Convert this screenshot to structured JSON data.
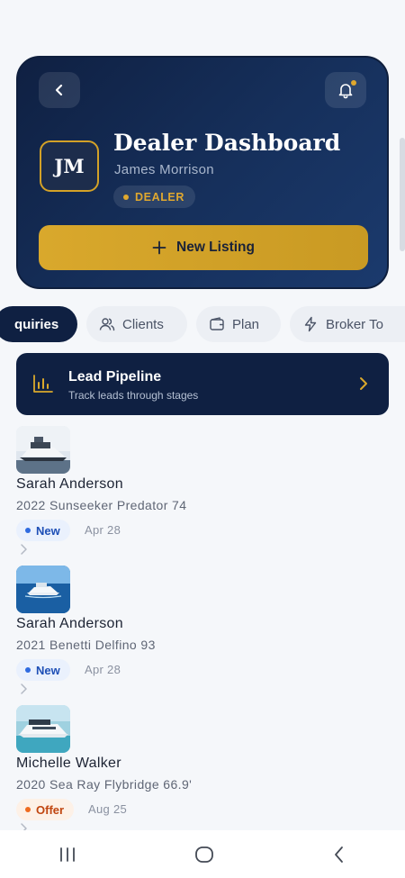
{
  "header": {
    "title": "Dealer Dashboard",
    "user_name": "James Morrison",
    "initials": "JM",
    "role_badge": "DEALER",
    "new_listing_label": "New Listing"
  },
  "tabs": [
    {
      "label": "quiries",
      "active": true
    },
    {
      "label": "Clients",
      "active": false
    },
    {
      "label": "Plan",
      "active": false
    },
    {
      "label": "Broker To",
      "active": false
    }
  ],
  "pipeline": {
    "title": "Lead Pipeline",
    "subtitle": "Track leads through stages"
  },
  "inquiries": [
    {
      "name": "Sarah Anderson",
      "yacht": "2022 Sunseeker Predator 74",
      "status": "New",
      "date": "Apr 28"
    },
    {
      "name": "Sarah Anderson",
      "yacht": "2021 Benetti Delfino 93",
      "status": "New",
      "date": "Apr 28"
    },
    {
      "name": "Michelle Walker",
      "yacht": "2020 Sea Ray Flybridge 66.9'",
      "status": "Offer",
      "date": "Aug 25"
    }
  ],
  "colors": {
    "navy": "#0f2042",
    "gold": "#d4a227",
    "status_new": "#2f6be0",
    "status_offer": "#ef6b1f"
  },
  "icons": {
    "back": "chevron-left-icon",
    "notifications": "bell-icon",
    "new_listing": "plus-icon",
    "clients": "users-icon",
    "plan": "wallet-icon",
    "broker_tools": "lightning-icon",
    "pipeline": "bar-chart-icon"
  }
}
